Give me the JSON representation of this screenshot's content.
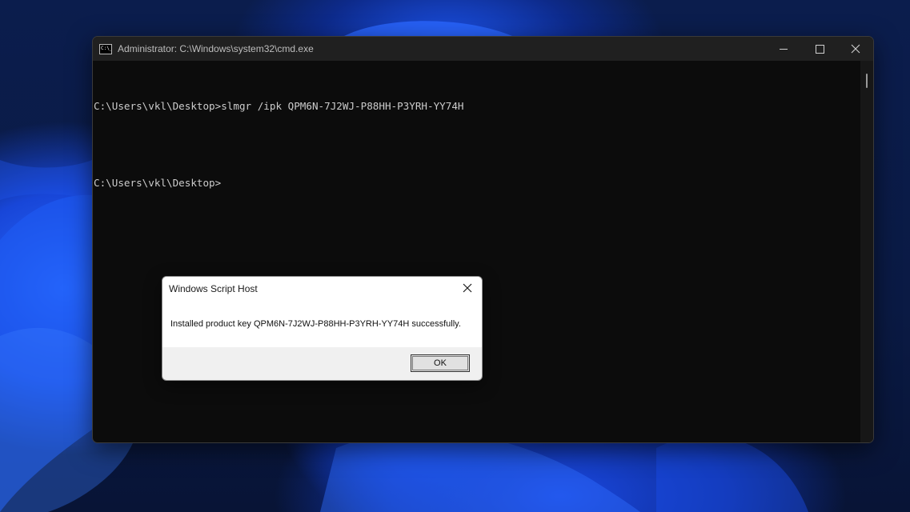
{
  "window": {
    "title": "Administrator: C:\\Windows\\system32\\cmd.exe",
    "app_icon_text": "C:\\_"
  },
  "console": {
    "lines": [
      "C:\\Users\\vkl\\Desktop>slmgr /ipk QPM6N-7J2WJ-P88HH-P3YRH-YY74H",
      "C:\\Users\\vkl\\Desktop>"
    ]
  },
  "dialog": {
    "title": "Windows Script Host",
    "message": "Installed product key QPM6N-7J2WJ-P88HH-P3YRH-YY74H successfully.",
    "ok_label": "OK"
  },
  "icons": {
    "minimize": "minimize-icon",
    "maximize": "maximize-icon",
    "close": "close-icon",
    "dialog_close": "close-icon"
  },
  "colors": {
    "console_bg": "#0c0c0c",
    "console_text": "#cccccc",
    "titlebar_bg": "#202020",
    "dialog_bg": "#f0f0f0",
    "wallpaper_accent": "#1e5cff"
  }
}
